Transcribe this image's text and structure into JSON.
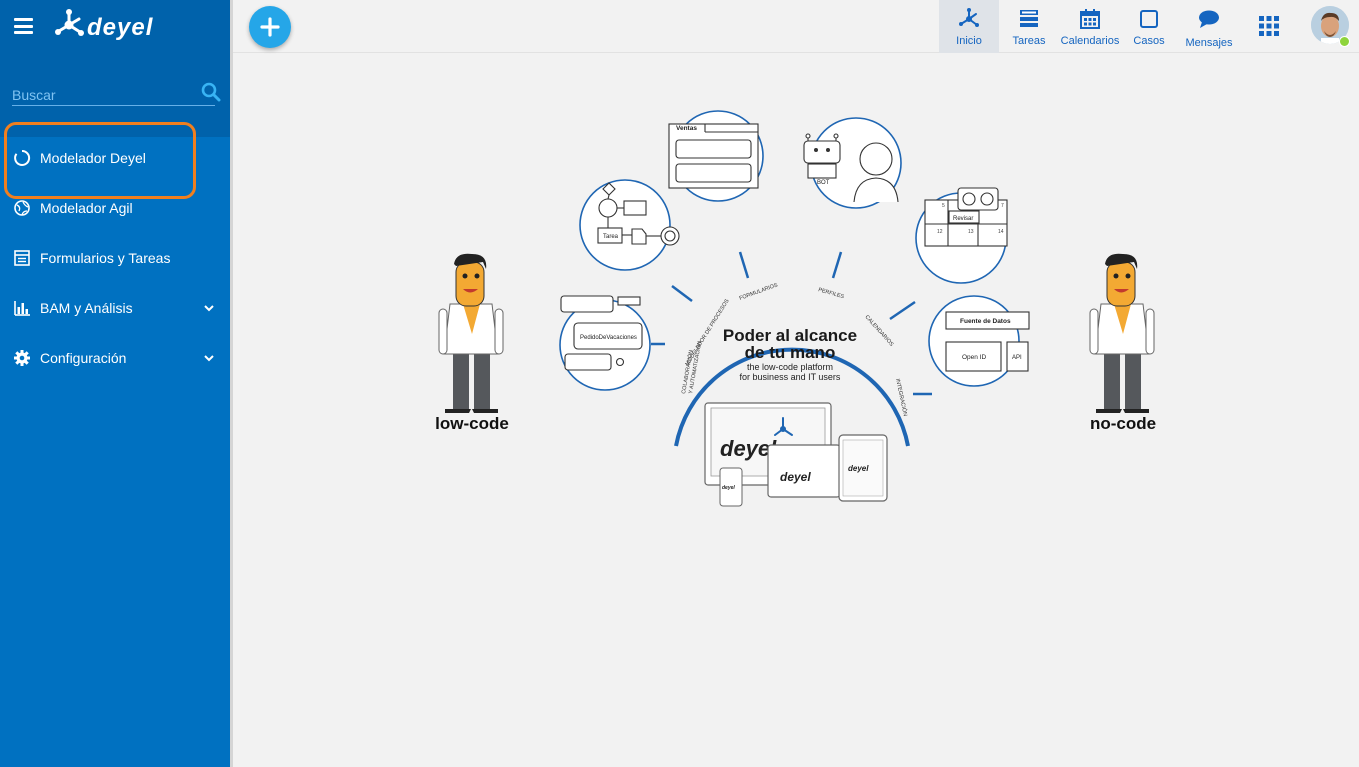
{
  "app": {
    "logo_text": "deyel"
  },
  "search": {
    "placeholder": "Buscar"
  },
  "sidebar": {
    "items": [
      {
        "label": "Modelador Deyel"
      },
      {
        "label": "Modelador Agil"
      },
      {
        "label": "Formularios y Tareas"
      },
      {
        "label": "BAM y Análisis"
      },
      {
        "label": "Configuración"
      }
    ]
  },
  "topbar": {
    "items": [
      {
        "label": "Inicio"
      },
      {
        "label": "Tareas"
      },
      {
        "label": "Calendarios"
      },
      {
        "label": "Casos"
      },
      {
        "label": "Mensajes"
      }
    ]
  },
  "hero": {
    "headline": "Poder al alcance",
    "headline2": "de tu mano",
    "sub1": "the low-code platform",
    "sub2": "for business and IT users",
    "left_label": "low-code",
    "right_label": "no-code",
    "arc_labels": {
      "colaboracion": "COLABORACIÓN",
      "automatizacion": "Y AUTOMATIZACIÓN",
      "modelador": "MODELADOR DE PROCESOS",
      "formularios": "FORMULARIOS",
      "perfiles": "PERFILES",
      "calendarios": "CALENDARIOS",
      "integracion": "INTEGRACIÓN"
    },
    "bubbles": {
      "ventas": "Ventas",
      "bot": "BOT",
      "revisar": "Revisar",
      "tarea": "Tarea",
      "pedido": "PedidoDeVacaciones",
      "fuente": "Fuente de Datos",
      "openid": "Open ID",
      "api": "API",
      "cal_5": "5",
      "cal_7": "7",
      "cal_12": "12",
      "cal_13": "13",
      "cal_14": "14"
    }
  },
  "colors": {
    "primary": "#0071c1",
    "accent": "#25a6e8",
    "highlight": "#f07f1e"
  }
}
